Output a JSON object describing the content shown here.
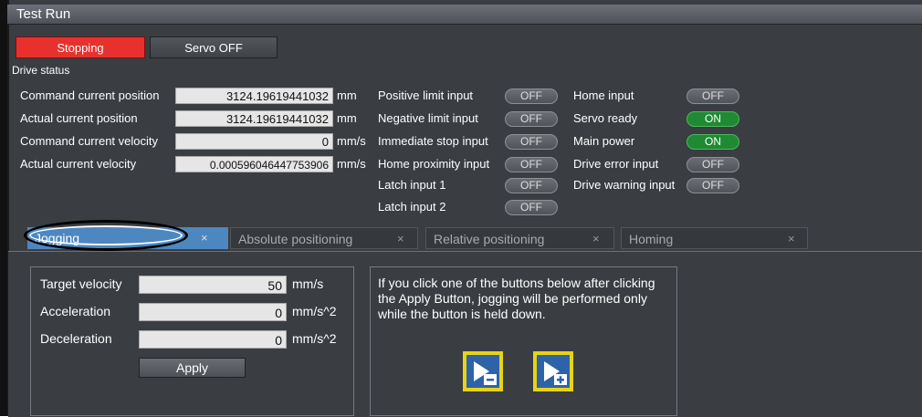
{
  "window": {
    "title": "Test Run"
  },
  "top_buttons": {
    "stopping": "Stopping",
    "servo_off": "Servo OFF"
  },
  "drive_status": {
    "heading": "Drive status",
    "fields": [
      {
        "label": "Command current position",
        "value": "3124.19619441032",
        "unit": "mm"
      },
      {
        "label": "Actual current position",
        "value": "3124.19619441032",
        "unit": "mm"
      },
      {
        "label": "Command current velocity",
        "value": "0",
        "unit": "mm/s"
      },
      {
        "label": "Actual current velocity",
        "value": "0.000596046447753906",
        "unit": "mm/s"
      }
    ],
    "inputs_left": [
      {
        "label": "Positive limit input",
        "state": "OFF"
      },
      {
        "label": "Negative limit input",
        "state": "OFF"
      },
      {
        "label": "Immediate stop input",
        "state": "OFF"
      },
      {
        "label": "Home proximity input",
        "state": "OFF"
      },
      {
        "label": "Latch input 1",
        "state": "OFF"
      },
      {
        "label": "Latch input 2",
        "state": "OFF"
      }
    ],
    "inputs_right": [
      {
        "label": "Home input",
        "state": "OFF"
      },
      {
        "label": "Servo ready",
        "state": "ON"
      },
      {
        "label": "Main power",
        "state": "ON"
      },
      {
        "label": "Drive error input",
        "state": "OFF"
      },
      {
        "label": "Drive warning input",
        "state": "OFF"
      }
    ]
  },
  "tabs": [
    {
      "label": "Jogging",
      "close": "×",
      "active": true
    },
    {
      "label": "Absolute positioning",
      "close": "×"
    },
    {
      "label": "Relative positioning",
      "close": "×"
    },
    {
      "label": "Homing",
      "close": "×"
    }
  ],
  "jog_settings": {
    "rows": [
      {
        "label": "Target velocity",
        "value": "50",
        "unit": "mm/s"
      },
      {
        "label": "Acceleration",
        "value": "0",
        "unit": "mm/s^2"
      },
      {
        "label": "Deceleration",
        "value": "0",
        "unit": "mm/s^2"
      }
    ],
    "apply_label": "Apply"
  },
  "instruction_text": "If you click one of the buttons below after clicking the Apply Button, jogging will be performed only while the button is held down.",
  "jog_buttons": [
    {
      "icon": "jog-negative-icon"
    },
    {
      "icon": "jog-positive-icon"
    }
  ],
  "colors": {
    "stopping": "#e8312d",
    "on": "#1f8a33",
    "active_tab": "#4d87c0",
    "jog_border": "#e8d315"
  }
}
